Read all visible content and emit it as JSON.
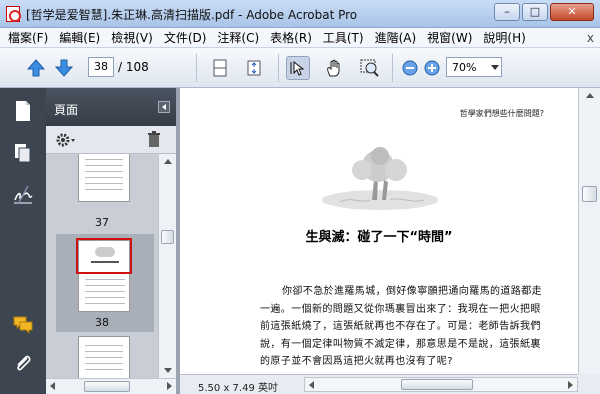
{
  "window": {
    "title": "[哲学是爱智慧].朱正琳.高清扫描版.pdf - Adobe Acrobat Pro",
    "minimize": "–",
    "maximize": "□",
    "close": "✕"
  },
  "menu": {
    "items": [
      "檔案(F)",
      "編輯(E)",
      "檢視(V)",
      "文件(D)",
      "注释(C)",
      "表格(R)",
      "工具(T)",
      "進階(A)",
      "視窗(W)",
      "說明(H)"
    ],
    "close_doc": "x"
  },
  "toolbar": {
    "page_number": "38",
    "page_total": "/ 108",
    "zoom": "70%",
    "icons": [
      "arrow-up-icon",
      "arrow-down-icon",
      "single-page-icon",
      "fit-page-icon",
      "select-cursor-icon",
      "hand-icon",
      "marquee-zoom-icon",
      "zoom-out-icon",
      "zoom-in-icon"
    ]
  },
  "leftrail": {
    "icons": [
      "pages-icon",
      "copy-pages-icon",
      "signature-icon",
      "comments-icon",
      "attachment-icon"
    ]
  },
  "panel": {
    "label": "頁面",
    "thumbnails": [
      {
        "label": "37"
      },
      {
        "label": "38",
        "selected": true
      }
    ]
  },
  "document": {
    "running_head": "哲學家們想些什麽問題?",
    "chapter_title": "生與滅：碰了一下“時間”",
    "paragraph": "你卻不急於進羅馬城，倒好像寧願把通向羅馬的道路都走一遍。一個新的問題又從你瑪裏冒出來了：我現在一把火把眼前這張紙燒了，這張紙就再也不存在了。可是：老師告訴我們說，有一個定律叫物質不滅定律，那意思是不是說，這張紙裏的原子並不會因爲這把火就再也沒有了呢?",
    "page_size": "5.50 x 7.49 英吋"
  },
  "colors": {
    "accent": "#2a5fbf",
    "panel_dark": "#3d4550",
    "doc_bg": "#6d7480",
    "highlight_red": "#d01010"
  }
}
